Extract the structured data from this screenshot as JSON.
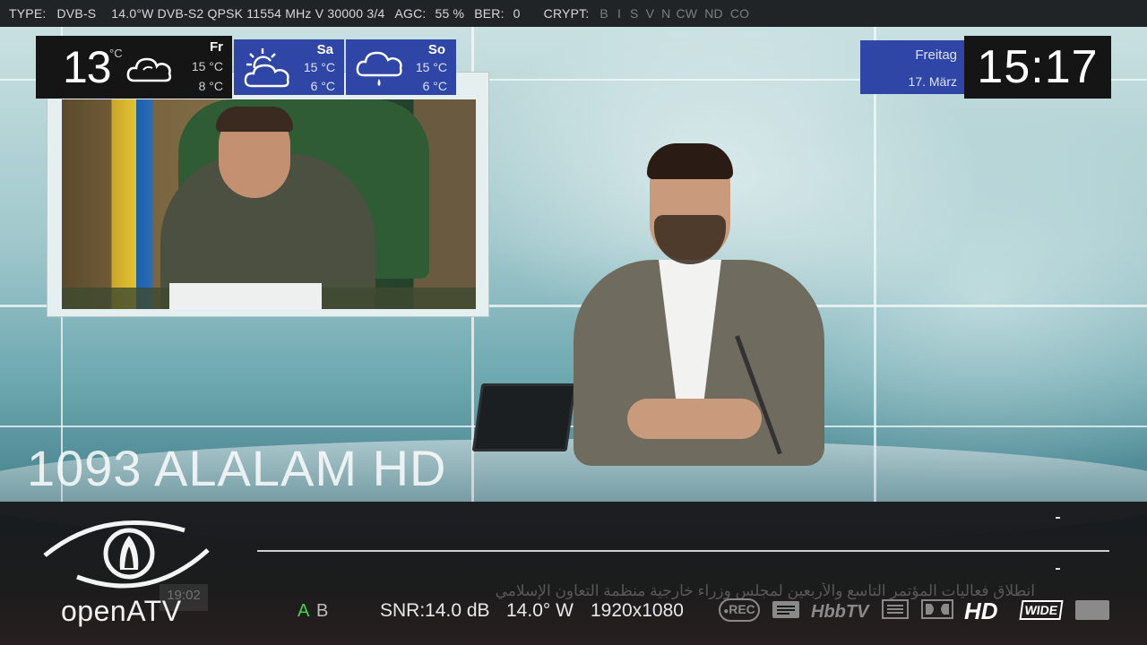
{
  "top_bar": {
    "type_label": "TYPE:",
    "type_value": "DVB-S",
    "tuner_info": "14.0°W DVB-S2 QPSK 11554 MHz V 30000 3/4",
    "agc_label": "AGC:",
    "agc_value": "55 %",
    "ber_label": "BER:",
    "ber_value": "0",
    "crypt_label": "CRYPT:",
    "crypt_systems": [
      "B",
      "I",
      "S",
      "V",
      "N",
      "CW",
      "ND",
      "CO"
    ]
  },
  "weather": {
    "current_temp": "13",
    "current_unit": "°C",
    "current_icon": "cloudy-icon",
    "forecast": [
      {
        "day": "Fr",
        "high": "15 °C",
        "low": "8 °C",
        "icon": "cloudy-icon"
      },
      {
        "day": "Sa",
        "high": "15 °C",
        "low": "6 °C",
        "icon": "partly-sunny-icon"
      },
      {
        "day": "So",
        "high": "15 °C",
        "low": "6 °C",
        "icon": "rain-cloud-icon"
      }
    ]
  },
  "clock": {
    "weekday": "Freitag",
    "date": "17. März",
    "time": "15:17"
  },
  "channel": {
    "number_name": "1093 ALALAM HD"
  },
  "ticker": {
    "time": "19:02",
    "text": "انطلاق فعاليات المؤتمر التاسع والأربعين لمجلس وزراء خارجية منظمة التعاون الإسلامي"
  },
  "infobar": {
    "logo_text": "openATV",
    "audio_a": "A",
    "audio_b": "B",
    "snr": "SNR:14.0 dB",
    "orbital": "14.0° W",
    "resolution": "1920x1080",
    "rec_label": "REC",
    "hbbtv_label": "HbbTV",
    "hd_label": "HD",
    "wide_label": "WIDE"
  },
  "colors": {
    "widget_blue": "#3046a7",
    "widget_dark": "#151515",
    "audio_active": "#3fd64a"
  }
}
